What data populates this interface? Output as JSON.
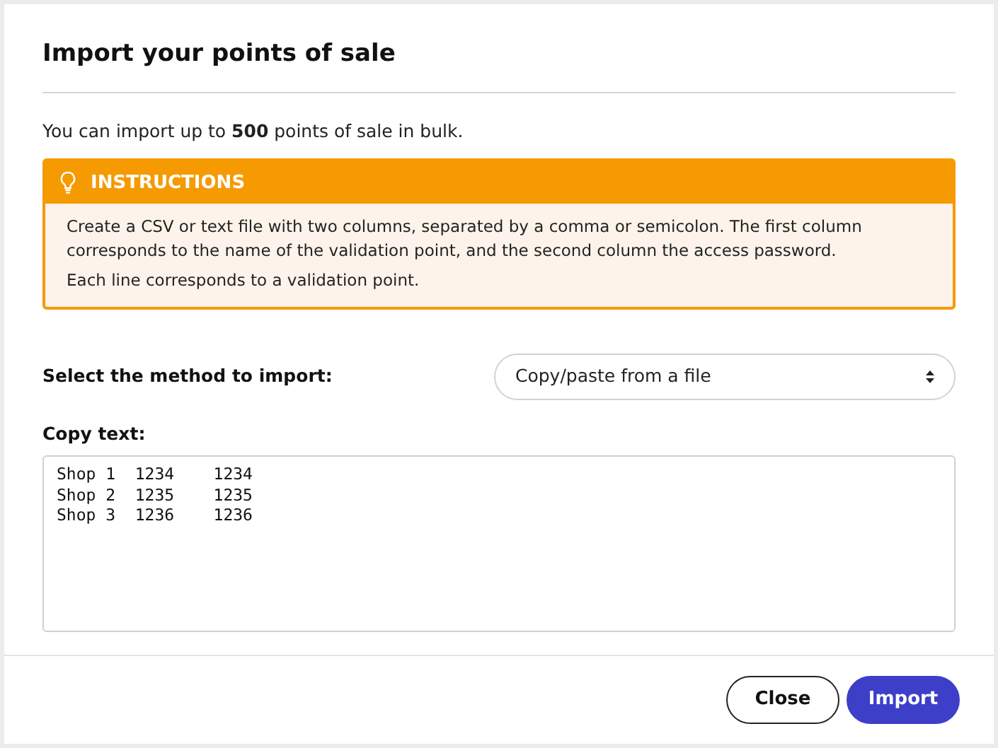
{
  "dialog": {
    "title": "Import your points of sale",
    "intro": "You can import up to **500** points of sale in bulk.",
    "instructions": {
      "heading": "INSTRUCTIONS",
      "paragraphs": [
        "Create a CSV or text file with two columns, separated by a comma or semicolon. The first column corresponds to the name of the validation point, and the second column the access password.",
        "Each line corresponds to a validation point."
      ]
    },
    "method": {
      "label": "Select the method to import:",
      "value": "Copy/paste from a file"
    },
    "copy_text": {
      "label": "Copy text:",
      "lines": [
        "Shop 1  1234    1234",
        "Shop 2  1235    1235",
        "Shop 3  1236    1236"
      ]
    },
    "buttons": [
      {
        "label": "Close",
        "kind": "secondary"
      },
      {
        "label": "Import",
        "kind": "primary"
      }
    ]
  }
}
